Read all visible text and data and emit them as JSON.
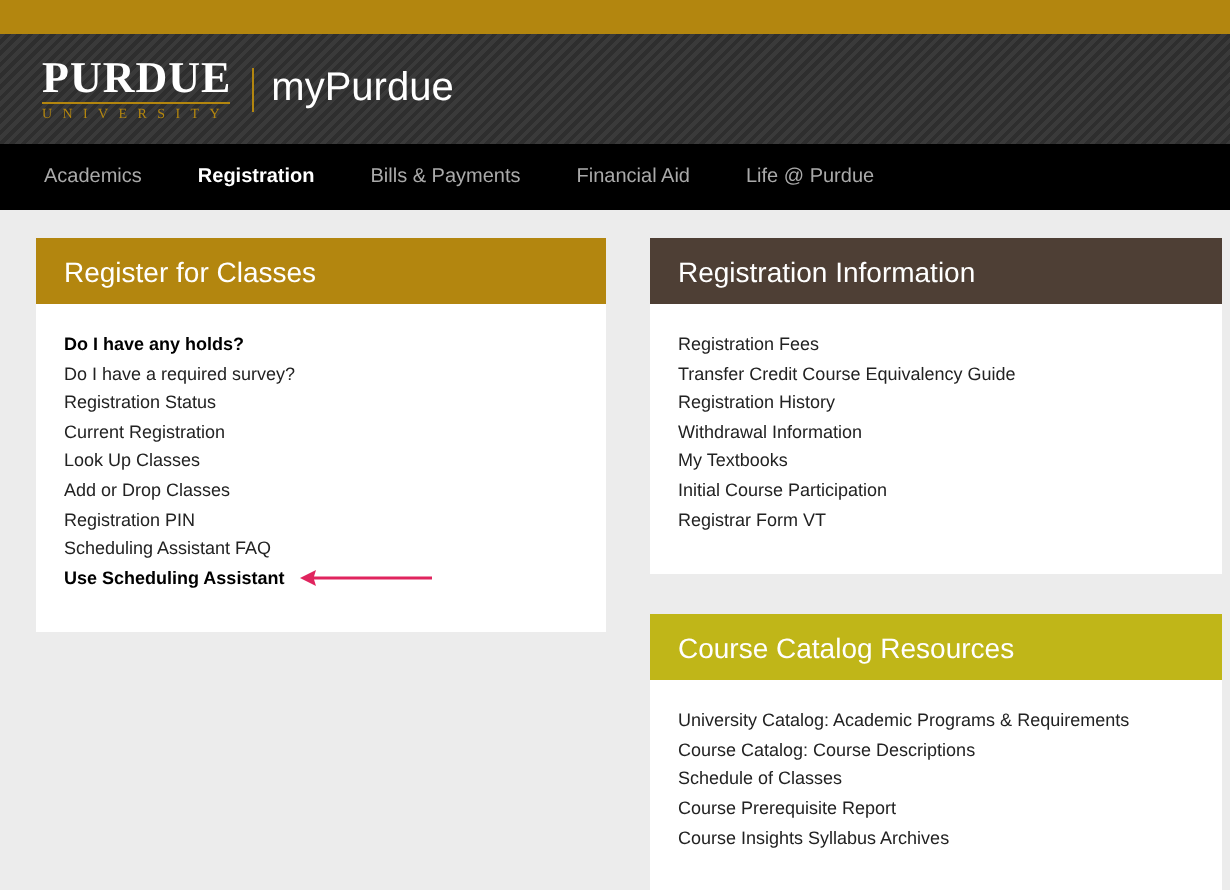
{
  "header": {
    "logo_wordmark": "PURDUE",
    "logo_subtitle": "UNIVERSITY",
    "site_title": "myPurdue"
  },
  "nav": [
    {
      "label": "Academics",
      "selected": false
    },
    {
      "label": "Registration",
      "selected": true
    },
    {
      "label": "Bills & Payments",
      "selected": false
    },
    {
      "label": "Financial Aid",
      "selected": false
    },
    {
      "label": "Life @ Purdue",
      "selected": false
    }
  ],
  "left_column": [
    {
      "title": "Register for Classes",
      "color": "#b3860f",
      "links": [
        {
          "label": "Do I have any holds?",
          "emphasized": true
        },
        {
          "label": "Do I have a required survey?",
          "emphasized": false
        },
        {
          "label": "Registration Status",
          "emphasized": false
        },
        {
          "label": "Current Registration",
          "emphasized": false
        },
        {
          "label": "Look Up Classes",
          "emphasized": false
        },
        {
          "label": "Add or Drop Classes",
          "emphasized": false
        },
        {
          "label": "Registration PIN",
          "emphasized": false
        },
        {
          "label": "Scheduling Assistant FAQ",
          "emphasized": false
        },
        {
          "label": "Use Scheduling Assistant",
          "emphasized": true,
          "annotated": true
        }
      ]
    }
  ],
  "right_column": [
    {
      "title": "Registration Information",
      "color": "#4e3f35",
      "links": [
        {
          "label": "Registration Fees",
          "emphasized": false
        },
        {
          "label": "Transfer Credit Course Equivalency Guide",
          "emphasized": false
        },
        {
          "label": "Registration History",
          "emphasized": false
        },
        {
          "label": "Withdrawal Information",
          "emphasized": false
        },
        {
          "label": "My Textbooks",
          "emphasized": false
        },
        {
          "label": "Initial Course Participation",
          "emphasized": false
        },
        {
          "label": "Registrar Form VT",
          "emphasized": false
        }
      ]
    },
    {
      "title": "Course Catalog Resources",
      "color": "#c0b618",
      "links": [
        {
          "label": "University Catalog: Academic Programs & Requirements",
          "emphasized": false
        },
        {
          "label": "Course Catalog: Course Descriptions",
          "emphasized": false
        },
        {
          "label": "Schedule of Classes",
          "emphasized": false
        },
        {
          "label": "Course Prerequisite Report",
          "emphasized": false
        },
        {
          "label": "Course Insights Syllabus Archives",
          "emphasized": false
        }
      ]
    }
  ]
}
